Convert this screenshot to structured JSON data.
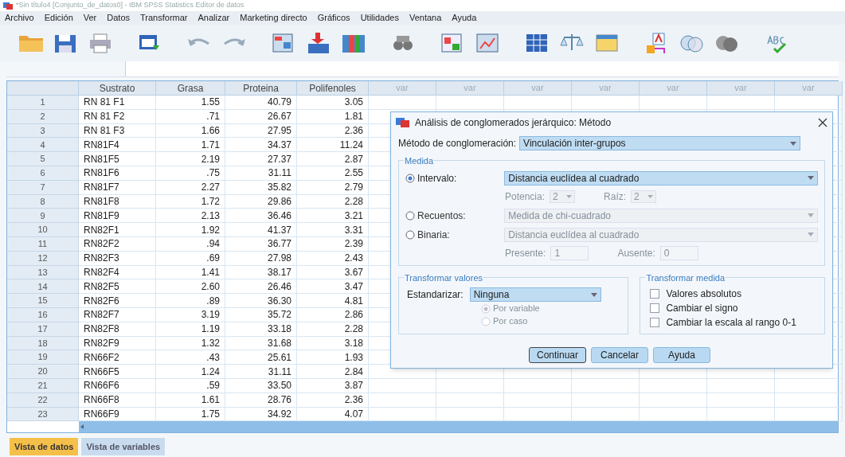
{
  "window": {
    "title": "*Sin título4 [Conjunto_de_datos0] - IBM SPSS Statistics Editor de datos"
  },
  "menu": [
    "Archivo",
    "Edición",
    "Ver",
    "Datos",
    "Transformar",
    "Analizar",
    "Marketing directo",
    "Gráficos",
    "Utilidades",
    "Ventana",
    "Ayuda"
  ],
  "table": {
    "columns": [
      "Sustrato",
      "Grasa",
      "Proteina",
      "Polifenoles",
      "var",
      "var",
      "var",
      "var",
      "var",
      "var",
      "var"
    ],
    "rows": [
      {
        "number": "1",
        "cells": [
          "RN 81 F1",
          "1.55",
          "40.79",
          "3.05"
        ]
      },
      {
        "number": "2",
        "cells": [
          "RN 81 F2",
          ".71",
          "26.67",
          "1.81"
        ]
      },
      {
        "number": "3",
        "cells": [
          "RN 81 F3",
          "1.66",
          "27.95",
          "2.36"
        ]
      },
      {
        "number": "4",
        "cells": [
          "RN81F4",
          "1.71",
          "34.37",
          "11.24"
        ]
      },
      {
        "number": "5",
        "cells": [
          "RN81F5",
          "2.19",
          "27.37",
          "2.87"
        ]
      },
      {
        "number": "6",
        "cells": [
          "RN81F6",
          ".75",
          "31.11",
          "2.55"
        ]
      },
      {
        "number": "7",
        "cells": [
          "RN81F7",
          "2.27",
          "35.82",
          "2.79"
        ]
      },
      {
        "number": "8",
        "cells": [
          "RN81F8",
          "1.72",
          "29.86",
          "2.28"
        ]
      },
      {
        "number": "9",
        "cells": [
          "RN81F9",
          "2.13",
          "36.46",
          "3.21"
        ]
      },
      {
        "number": "10",
        "cells": [
          "RN82F1",
          "1.92",
          "41.37",
          "3.31"
        ]
      },
      {
        "number": "11",
        "cells": [
          "RN82F2",
          ".94",
          "36.77",
          "2.39"
        ]
      },
      {
        "number": "12",
        "cells": [
          "RN82F3",
          ".69",
          "27.98",
          "2.43"
        ]
      },
      {
        "number": "13",
        "cells": [
          "RN82F4",
          "1.41",
          "38.17",
          "3.67"
        ]
      },
      {
        "number": "14",
        "cells": [
          "RN82F5",
          "2.60",
          "26.46",
          "3.47"
        ]
      },
      {
        "number": "15",
        "cells": [
          "RN82F6",
          ".89",
          "36.30",
          "4.81"
        ]
      },
      {
        "number": "16",
        "cells": [
          "RN82F7",
          "3.19",
          "35.72",
          "2.86"
        ]
      },
      {
        "number": "17",
        "cells": [
          "RN82F8",
          "1.19",
          "33.18",
          "2.28"
        ]
      },
      {
        "number": "18",
        "cells": [
          "RN82F9",
          "1.32",
          "31.68",
          "3.18"
        ]
      },
      {
        "number": "19",
        "cells": [
          "RN66F2",
          ".43",
          "25.61",
          "1.93"
        ]
      },
      {
        "number": "20",
        "cells": [
          "RN66F5",
          "1.24",
          "31.11",
          "2.84"
        ]
      },
      {
        "number": "21",
        "cells": [
          "RN66F6",
          ".59",
          "33.50",
          "3.87"
        ]
      },
      {
        "number": "22",
        "cells": [
          "RN66F8",
          "1.61",
          "28.76",
          "2.36"
        ]
      },
      {
        "number": "23",
        "cells": [
          "RN66F9",
          "1.75",
          "34.92",
          "4.07"
        ]
      }
    ]
  },
  "view_tabs": [
    {
      "label": "Vista de datos",
      "selected": true
    },
    {
      "label": "Vista de variables",
      "selected": false
    }
  ],
  "dialog": {
    "title": "Análisis de conglomerados jerárquico: Método",
    "method": {
      "label": "Método de conglomeración:",
      "value": "Vinculación inter-grupos"
    },
    "measure": {
      "legend": "Medida",
      "options": [
        {
          "label": "Intervalo:",
          "selected": true,
          "value": "Distancia euclídea al cuadrado",
          "disabled": false,
          "params": [
            {
              "label": "Potencia:",
              "value": "2",
              "kind": "dropdown"
            },
            {
              "label": "Raíz:",
              "value": "2",
              "kind": "dropdown"
            }
          ]
        },
        {
          "label": "Recuentos:",
          "selected": false,
          "value": "Medida de chi-cuadrado",
          "disabled": true
        },
        {
          "label": "Binaria:",
          "selected": false,
          "value": "Distancia euclídea al cuadrado",
          "disabled": true,
          "params": [
            {
              "label": "Presente:",
              "value": "1",
              "kind": "input"
            },
            {
              "label": "Ausente:",
              "value": "0",
              "kind": "input"
            }
          ]
        }
      ]
    },
    "transform_values": {
      "legend": "Transformar valores",
      "label": "Estandarizar:",
      "value": "Ninguna",
      "options": [
        {
          "label": "Por variable",
          "selected": true,
          "disabled": true
        },
        {
          "label": "Por caso",
          "selected": false,
          "disabled": true
        }
      ]
    },
    "transform_measure": {
      "legend": "Transformar medida",
      "options": [
        {
          "label": "Valores absolutos",
          "checked": false
        },
        {
          "label": "Cambiar el signo",
          "checked": false
        },
        {
          "label": "Cambiar la escala al rango 0-1",
          "checked": false
        }
      ]
    },
    "buttons": [
      {
        "label": "Continuar",
        "focused": true
      },
      {
        "label": "Cancelar",
        "focused": false
      },
      {
        "label": "Ayuda",
        "focused": false
      }
    ]
  }
}
